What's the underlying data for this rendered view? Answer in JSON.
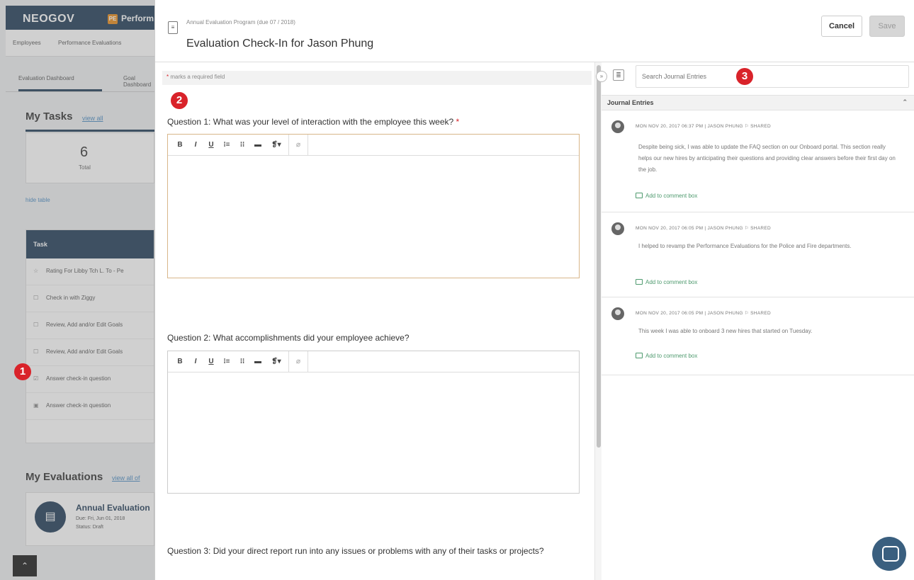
{
  "background_app": {
    "brand": "NEOGOV",
    "product_badge": "PE",
    "product_name": "Perform",
    "nav": [
      "Employees",
      "Performance Evaluations"
    ],
    "tabs": [
      "Evaluation Dashboard",
      "Goal Dashboard"
    ],
    "my_tasks": {
      "heading": "My Tasks",
      "view_all": "view all"
    },
    "total_card": {
      "count": "6",
      "label": "Total"
    },
    "hide_table": "hide table",
    "task_table": {
      "header": "Task",
      "rows": [
        {
          "icon": "☆",
          "text": "Rating For Libby Tch L. To - Pe"
        },
        {
          "icon": "☐",
          "text": "Check in with Ziggy"
        },
        {
          "icon": "☐",
          "text": "Review, Add and/or Edit Goals"
        },
        {
          "icon": "☐",
          "text": "Review, Add and/or Edit Goals"
        },
        {
          "icon": "☑",
          "text": "Answer check-in question"
        },
        {
          "icon": "▣",
          "text": "Answer check-in question"
        }
      ]
    },
    "my_evaluations": {
      "heading": "My Evaluations",
      "view_all": "view all of"
    },
    "eval_card": {
      "title": "Annual Evaluation",
      "due": "Due: Fri, Jun 01, 2018",
      "status": "Status: Draft"
    }
  },
  "modal": {
    "breadcrumb": "Annual Evaluation Program (due 07 / 2018)",
    "title": "Evaluation Check-In for Jason Phung",
    "cancel_label": "Cancel",
    "save_label": "Save",
    "required_note": "marks a required field",
    "toolbar": {
      "bold": "B",
      "italic": "I",
      "underline": "U",
      "ordered_list": "⁝≡",
      "bullet_list": "⁝⁝",
      "hr": "▬",
      "style": "❡▾",
      "link": "⌀"
    },
    "questions": [
      {
        "text": "Question 1: What was your level of interaction with the employee this week?",
        "required": "*"
      },
      {
        "text": "Question 2: What accomplishments did your employee achieve?"
      },
      {
        "text": "Question 3: Did your direct report run into any issues or problems with any of their tasks or projects?"
      }
    ]
  },
  "journal": {
    "search_placeholder": "Search Journal Entries",
    "section_title": "Journal Entries",
    "entries": [
      {
        "meta": "MON NOV 20, 2017 06:37 PM  |  JASON PHUNG  ⚐  SHARED",
        "text": "Despite being sick, I was able to update the FAQ section on our Onboard portal. This section really helps our new hires by anticipating their questions and providing clear answers before their first day on the job.",
        "add_link": "Add to comment box"
      },
      {
        "meta": "MON NOV 20, 2017 06:05 PM  |  JASON PHUNG  ⚐  SHARED",
        "text": "I helped to revamp the Performance Evaluations for the Police and Fire departments.",
        "add_link": "Add to comment box"
      },
      {
        "meta": "MON NOV 20, 2017 06:05 PM  |  JASON PHUNG  ⚐  SHARED",
        "text": "This week I was able to onboard 3 new hires that started on Tuesday.",
        "add_link": "Add to comment box"
      }
    ]
  },
  "annotations": [
    "1",
    "2",
    "3"
  ]
}
